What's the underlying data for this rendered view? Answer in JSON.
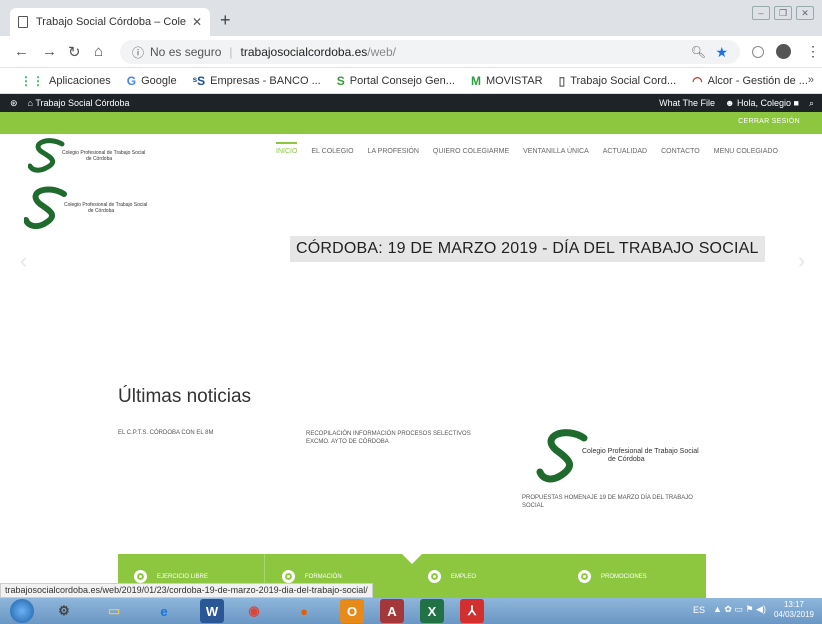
{
  "browser": {
    "tab_title": "Trabajo Social Córdoba – Colegio",
    "new_tab": "+",
    "url_security": "No es seguro",
    "url_host": "trabajosocialcordoba.es",
    "url_path": "/web/"
  },
  "bookmarks": [
    {
      "icon": "apps-icon",
      "label": "Aplicaciones"
    },
    {
      "icon": "google-icon",
      "label": "Google"
    },
    {
      "icon": "bs-icon",
      "label": "Empresas - BANCO ..."
    },
    {
      "icon": "portal-icon",
      "label": "Portal Consejo Gen..."
    },
    {
      "icon": "movistar-icon",
      "label": "MOVISTAR"
    },
    {
      "icon": "doc-icon",
      "label": "Trabajo Social Cord..."
    },
    {
      "icon": "alcor-icon",
      "label": "Alcor - Gestión de ..."
    }
  ],
  "adminbar": {
    "site_name": "Trabajo Social Córdoba",
    "right_1": "What The File",
    "right_2": "Hola, Colegio"
  },
  "site": {
    "logout": "CERRAR SESIÓN",
    "logo_text_1": "Colegio Profesional de Trabajo Social",
    "logo_text_2": "de Córdoba",
    "nav": [
      "INICIO",
      "EL COLEGIO",
      "LA PROFESIÓN",
      "QUIERO COLEGIARME",
      "VENTANILLA ÚNICA",
      "ACTUALIDAD",
      "CONTACTO",
      "MENU COLEGIADO"
    ],
    "hero_title": "CÓRDOBA: 19 DE MARZO 2019 - DÍA DEL TRABAJO SOCIAL",
    "news_heading": "Últimas noticias",
    "news": [
      "EL C.P.T.S. CÓRDOBA CON EL 8M",
      "RECOPILACIÓN INFORMACIÓN PROCESOS SELECTIVOS EXCMO. AYTO DE CÓRDOBA",
      "PROPUESTAS HOMENAJE 19 DE MARZO DÍA DEL TRABAJO SOCIAL"
    ],
    "band_items": [
      "EJERCICIO LIBRE",
      "FORMACIÓN",
      "EMPLEO",
      "PROMOCIONES"
    ]
  },
  "status_url": "trabajosocialcordoba.es/web/2019/01/23/cordoba-19-de-marzo-2019-dia-del-trabajo-social/",
  "taskbar": {
    "lang": "ES",
    "time": "13:17",
    "date": "04/03/2019"
  },
  "colors": {
    "accent": "#8dc63f",
    "adminbar": "#1d2327"
  }
}
